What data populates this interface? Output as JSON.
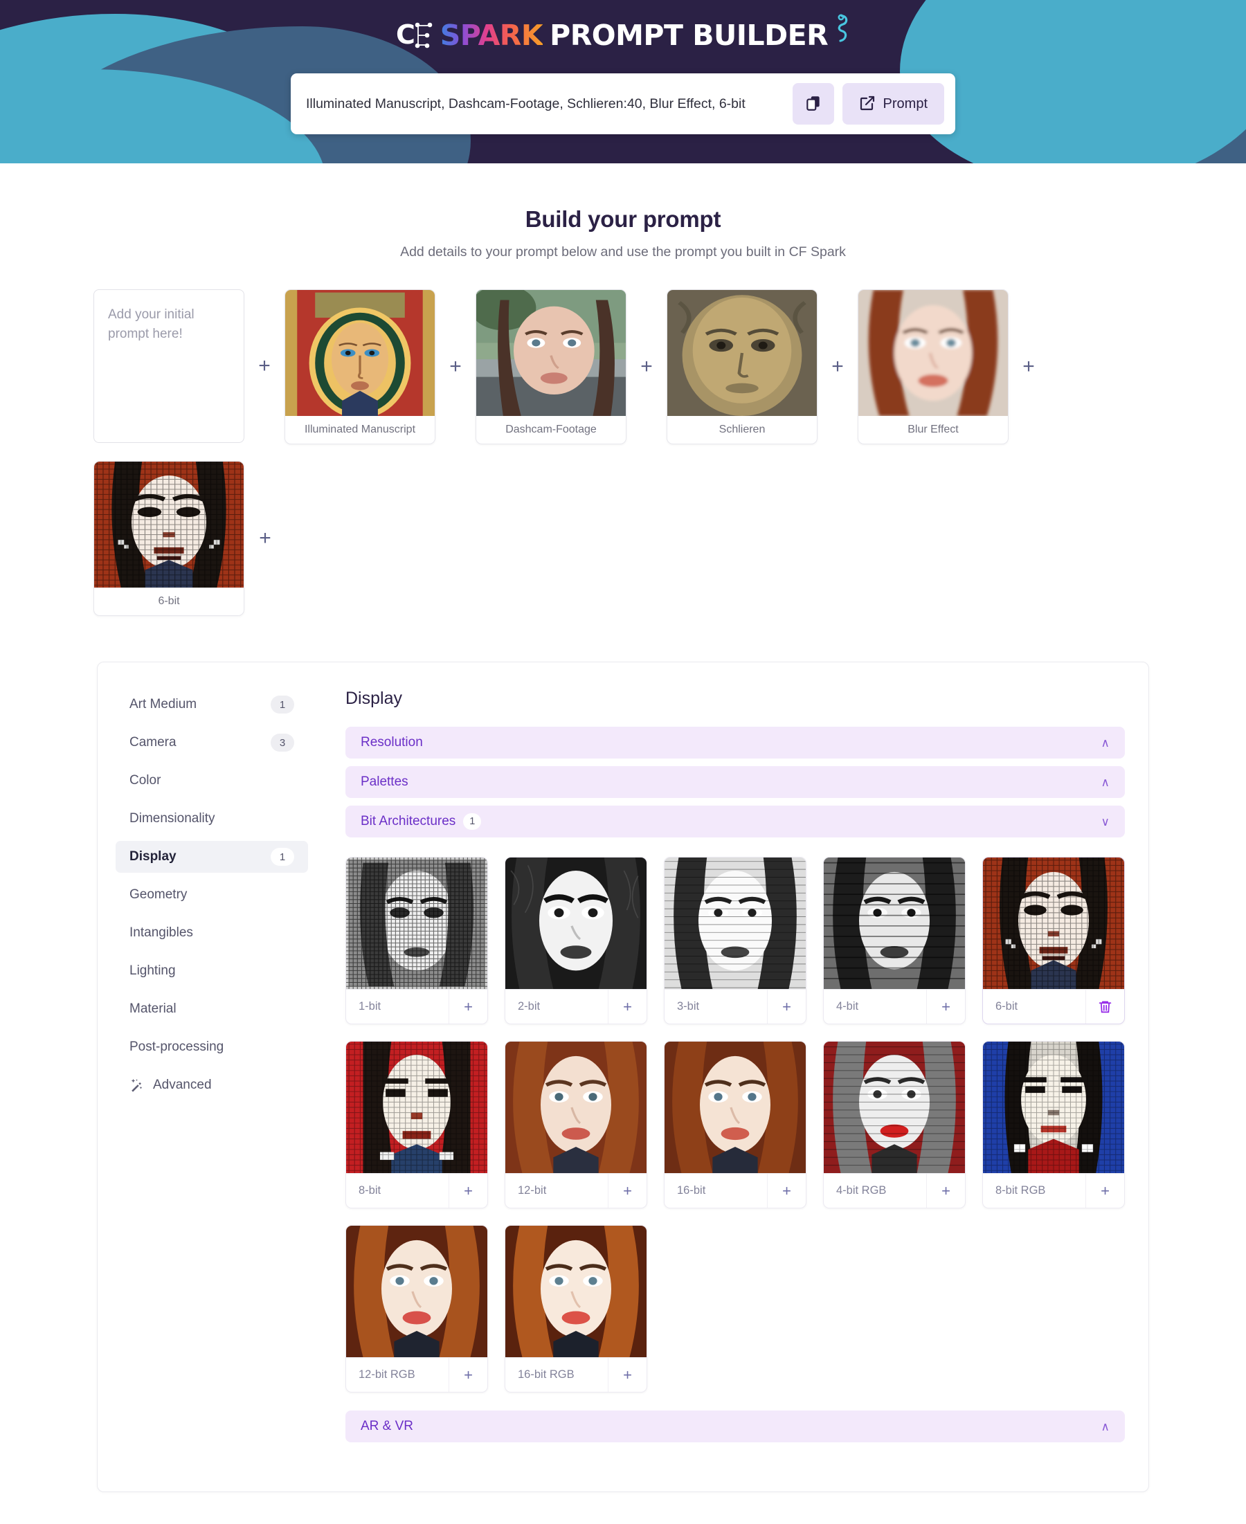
{
  "header": {
    "logo": {
      "cf_mark": "CF",
      "spark_word": "SPARK",
      "rest_words": "PROMPT BUILDER"
    },
    "prompt_value": "Illuminated Manuscript, Dashcam-Footage, Schlieren:40, Blur Effect, 6-bit",
    "copy_icon": "copy-icon",
    "prompt_button_label": "Prompt",
    "external_icon": "external-link-icon"
  },
  "intro": {
    "title": "Build your prompt",
    "subtitle": "Add details to your prompt below and use the prompt you built in CF Spark"
  },
  "builder": {
    "initial_placeholder": "Add your initial prompt here!",
    "initial_value": "",
    "separator": "+",
    "chips": [
      {
        "label": "Illuminated Manuscript"
      },
      {
        "label": "Dashcam-Footage"
      },
      {
        "label": "Schlieren"
      },
      {
        "label": "Blur Effect"
      },
      {
        "label": "6-bit"
      }
    ]
  },
  "sidebar": {
    "items": [
      {
        "label": "Art Medium",
        "count": "1",
        "active": false,
        "icon": ""
      },
      {
        "label": "Camera",
        "count": "3",
        "active": false,
        "icon": ""
      },
      {
        "label": "Color",
        "count": "",
        "active": false,
        "icon": ""
      },
      {
        "label": "Dimensionality",
        "count": "",
        "active": false,
        "icon": ""
      },
      {
        "label": "Display",
        "count": "1",
        "active": true,
        "icon": ""
      },
      {
        "label": "Geometry",
        "count": "",
        "active": false,
        "icon": ""
      },
      {
        "label": "Intangibles",
        "count": "",
        "active": false,
        "icon": ""
      },
      {
        "label": "Lighting",
        "count": "",
        "active": false,
        "icon": ""
      },
      {
        "label": "Material",
        "count": "",
        "active": false,
        "icon": ""
      },
      {
        "label": "Post-processing",
        "count": "",
        "active": false,
        "icon": ""
      },
      {
        "label": "Advanced",
        "count": "",
        "active": false,
        "icon": "magic-wand-icon"
      }
    ]
  },
  "content": {
    "title": "Display",
    "accordions_top": [
      {
        "label": "Resolution",
        "count": "",
        "state": "collapsed",
        "chevron": "∧"
      },
      {
        "label": "Palettes",
        "count": "",
        "state": "collapsed",
        "chevron": "∧"
      },
      {
        "label": "Bit Architectures",
        "count": "1",
        "state": "expanded",
        "chevron": "∨"
      }
    ],
    "accordion_bottom": {
      "label": "AR & VR",
      "count": "",
      "state": "collapsed",
      "chevron": "∧"
    },
    "add_symbol": "+",
    "remove_symbol": "trash-icon",
    "items": [
      {
        "label": "1-bit",
        "selected": false
      },
      {
        "label": "2-bit",
        "selected": false
      },
      {
        "label": "3-bit",
        "selected": false
      },
      {
        "label": "4-bit",
        "selected": false
      },
      {
        "label": "6-bit",
        "selected": true
      },
      {
        "label": "8-bit",
        "selected": false
      },
      {
        "label": "12-bit",
        "selected": false
      },
      {
        "label": "16-bit",
        "selected": false
      },
      {
        "label": "4-bit RGB",
        "selected": false
      },
      {
        "label": "8-bit RGB",
        "selected": false
      },
      {
        "label": "12-bit RGB",
        "selected": false
      },
      {
        "label": "16-bit RGB",
        "selected": false
      }
    ]
  },
  "colors": {
    "header_bg": "#2b2145",
    "teal_blob": "#4aadca",
    "blue_blob": "#3f6184",
    "accent_purple": "#6b2fc7",
    "accordion_bg": "#f3e9fb",
    "trash_purple": "#9326e8",
    "button_bg": "#e9e2f7"
  }
}
